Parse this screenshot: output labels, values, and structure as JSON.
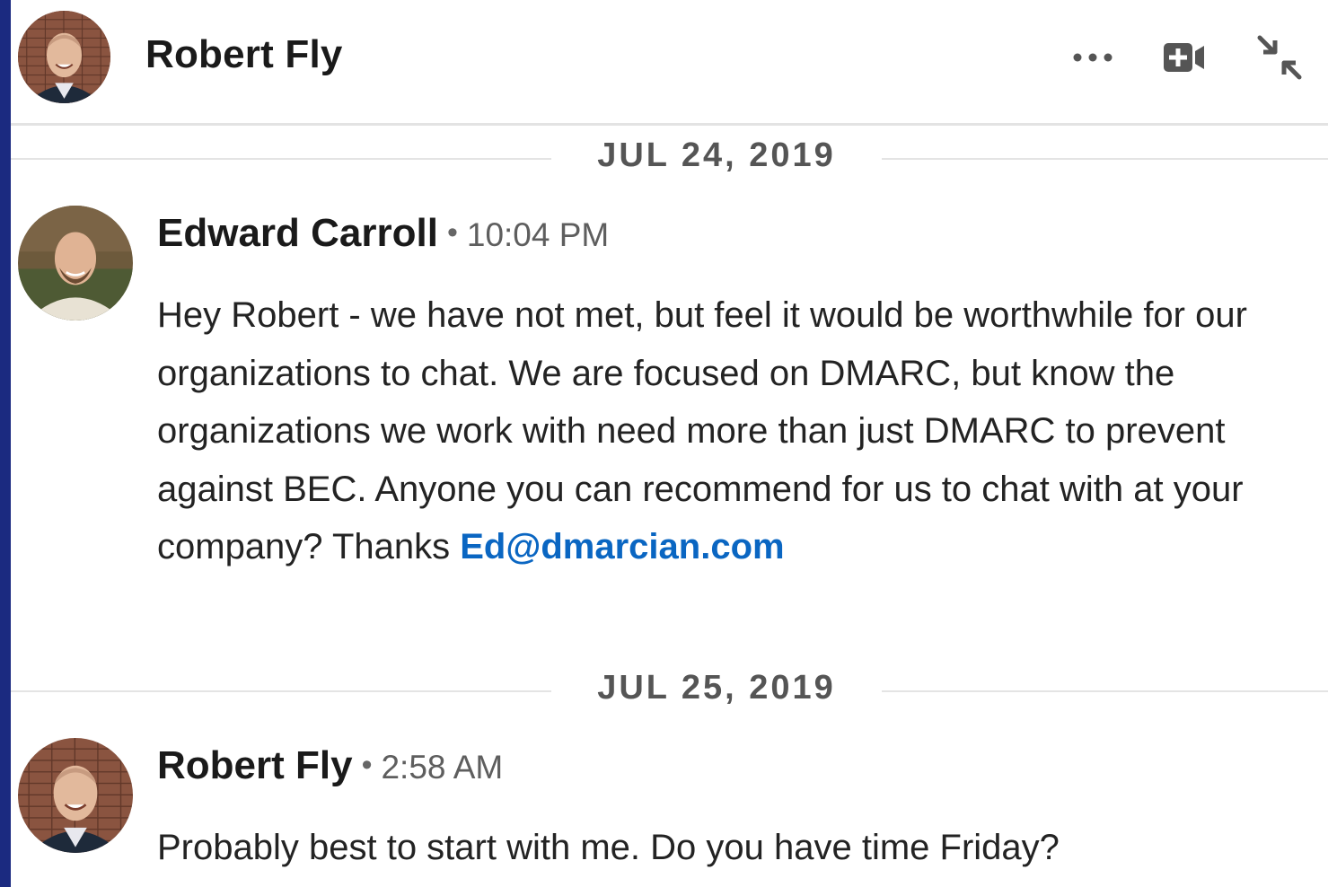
{
  "header": {
    "title": "Robert Fly",
    "avatar_icon": "profile-photo-robert-fly",
    "actions": [
      {
        "name": "more-options",
        "icon": "ellipsis-icon"
      },
      {
        "name": "video-call",
        "icon": "video-camera-plus-icon"
      },
      {
        "name": "minimize",
        "icon": "collapse-arrows-icon"
      }
    ]
  },
  "thread": {
    "dividers": [
      {
        "label": "JUL 24, 2019"
      },
      {
        "label": "JUL 25, 2019"
      }
    ],
    "messages": [
      {
        "sender": "Edward Carroll",
        "separator": "•",
        "time": "10:04 PM",
        "body": "Hey Robert - we have not met, but feel it would be worthwhile for our organizations to chat. We are focused on DMARC, but know the organizations we work with need more than just DMARC to prevent against BEC. Anyone you can recommend for us to chat with at your company? Thanks ",
        "link": "Ed@dmarcian.com"
      },
      {
        "sender": "Robert Fly",
        "separator": "•",
        "time": "2:58 AM",
        "body": "Probably best to start with me. Do you have time Friday?"
      }
    ]
  },
  "colors": {
    "accent_bar": "#1b2a80",
    "link": "#0a66c2",
    "divider": "#e4e4e4"
  }
}
